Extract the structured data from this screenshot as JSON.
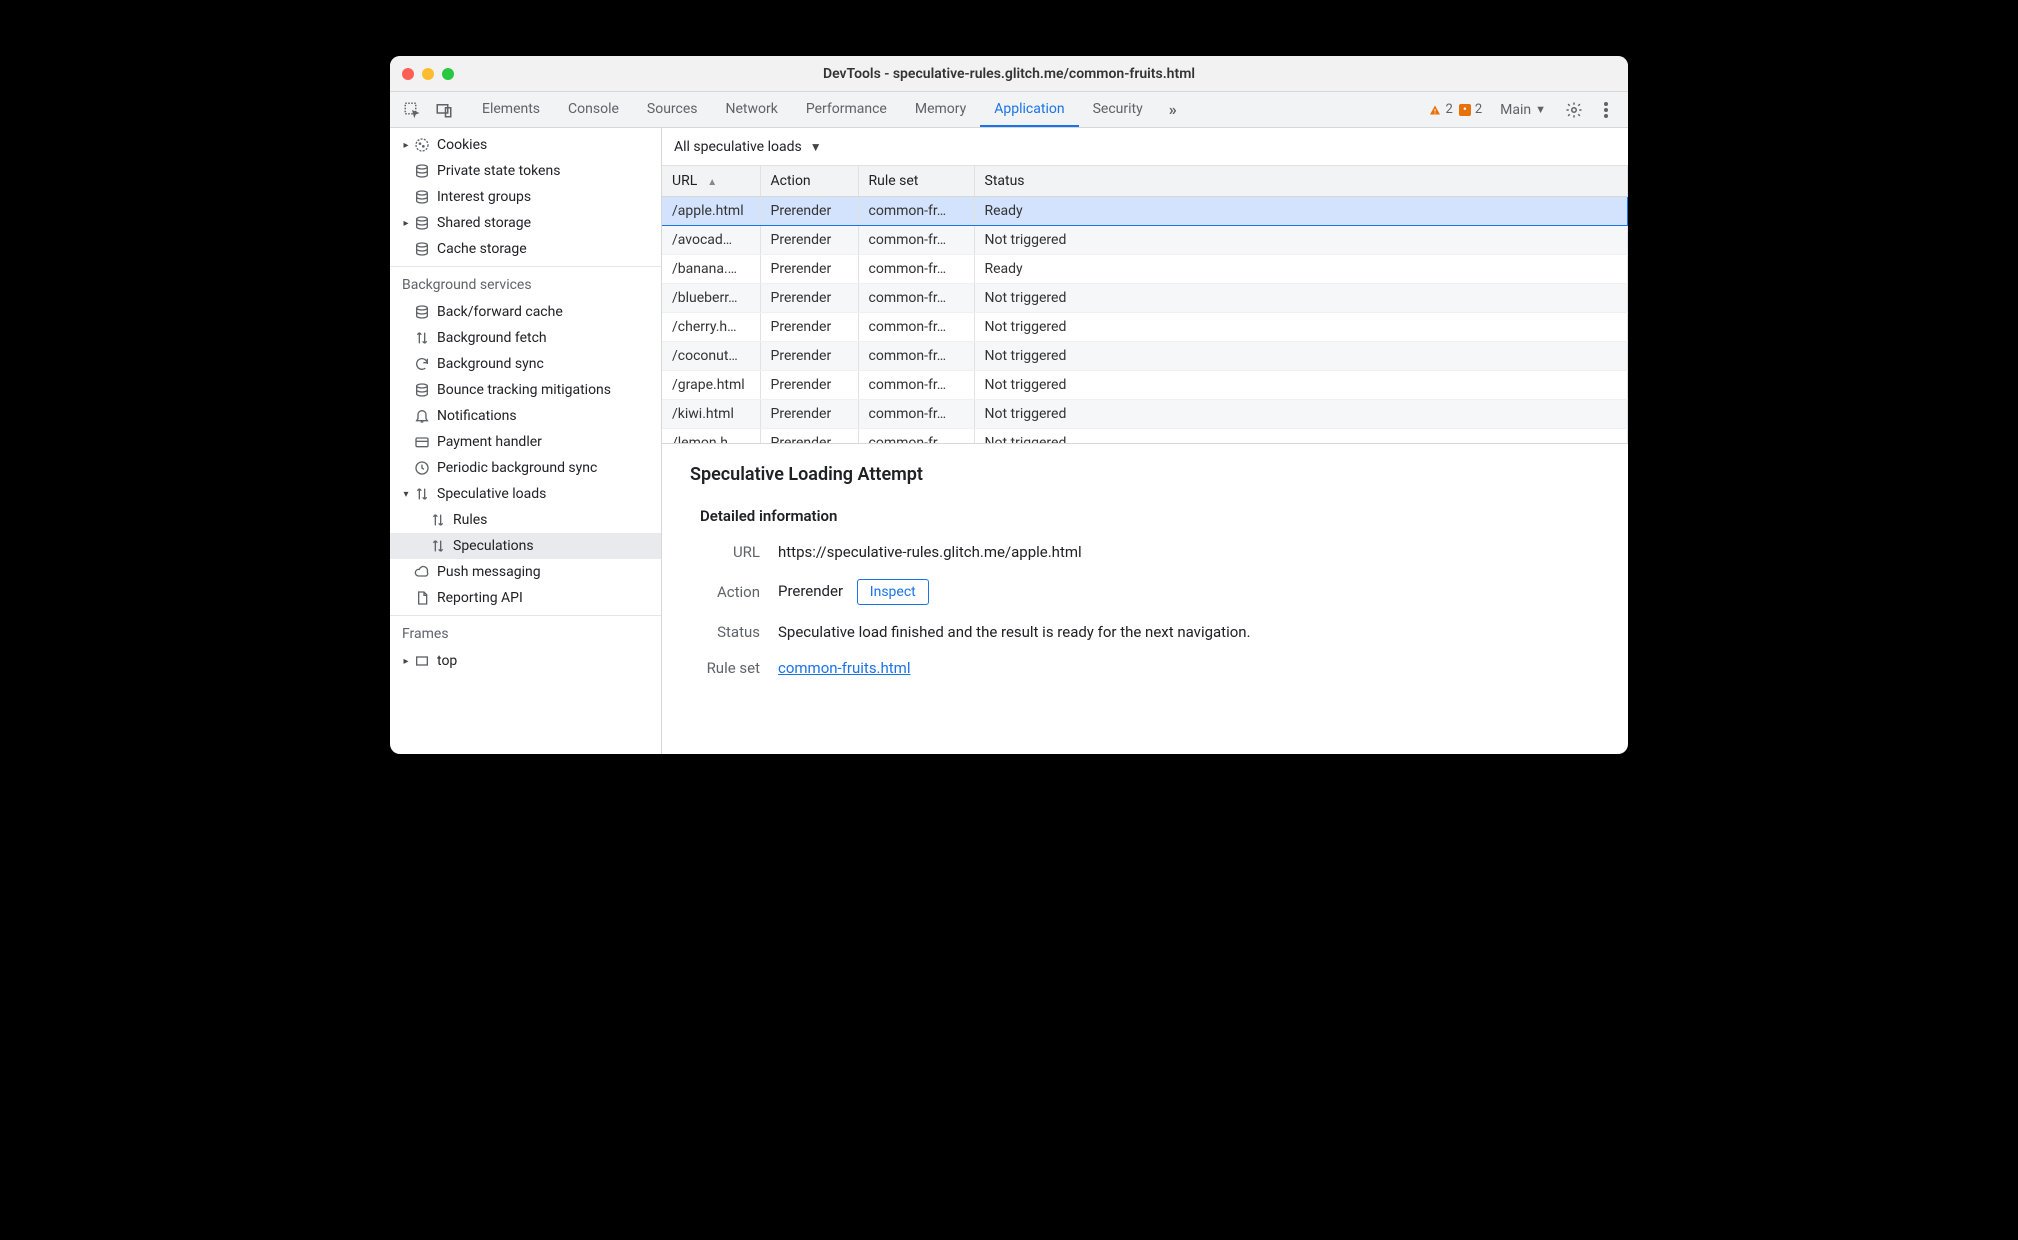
{
  "window": {
    "title": "DevTools - speculative-rules.glitch.me/common-fruits.html"
  },
  "toolbar": {
    "tabs": [
      "Elements",
      "Console",
      "Sources",
      "Network",
      "Performance",
      "Memory",
      "Application",
      "Security"
    ],
    "active_tab_index": 6,
    "warnings_count": "2",
    "issues_count": "2",
    "context": "Main"
  },
  "sidebar": {
    "group1_items": [
      {
        "label": "Cookies",
        "icon": "cookie",
        "caret": "right",
        "indent": 0
      },
      {
        "label": "Private state tokens",
        "icon": "db",
        "indent": 0
      },
      {
        "label": "Interest groups",
        "icon": "db",
        "indent": 0
      },
      {
        "label": "Shared storage",
        "icon": "db",
        "caret": "right",
        "indent": 0
      },
      {
        "label": "Cache storage",
        "icon": "db",
        "indent": 0
      }
    ],
    "group2_label": "Background services",
    "group2_items": [
      {
        "label": "Back/forward cache",
        "icon": "db",
        "indent": 0
      },
      {
        "label": "Background fetch",
        "icon": "arrows",
        "indent": 0
      },
      {
        "label": "Background sync",
        "icon": "sync",
        "indent": 0
      },
      {
        "label": "Bounce tracking mitigations",
        "icon": "db",
        "indent": 0
      },
      {
        "label": "Notifications",
        "icon": "bell",
        "indent": 0
      },
      {
        "label": "Payment handler",
        "icon": "card",
        "indent": 0
      },
      {
        "label": "Periodic background sync",
        "icon": "clock",
        "indent": 0
      },
      {
        "label": "Speculative loads",
        "icon": "arrows",
        "caret": "down",
        "indent": 0
      },
      {
        "label": "Rules",
        "icon": "arrows",
        "indent": 1
      },
      {
        "label": "Speculations",
        "icon": "arrows",
        "indent": 1,
        "selected": true
      },
      {
        "label": "Push messaging",
        "icon": "cloud",
        "indent": 0
      },
      {
        "label": "Reporting API",
        "icon": "file",
        "indent": 0
      }
    ],
    "group3_label": "Frames",
    "group3_items": [
      {
        "label": "top",
        "icon": "frame",
        "caret": "right",
        "indent": 0
      }
    ]
  },
  "filter": {
    "label": "All speculative loads"
  },
  "table": {
    "columns": [
      "URL",
      "Action",
      "Rule set",
      "Status"
    ],
    "sort_col_index": 0,
    "rows": [
      {
        "url": "/apple.html",
        "action": "Prerender",
        "ruleset": "common-fr…",
        "status": "Ready",
        "selected": true
      },
      {
        "url": "/avocad…",
        "action": "Prerender",
        "ruleset": "common-fr…",
        "status": "Not triggered"
      },
      {
        "url": "/banana.…",
        "action": "Prerender",
        "ruleset": "common-fr…",
        "status": "Ready"
      },
      {
        "url": "/blueberr…",
        "action": "Prerender",
        "ruleset": "common-fr…",
        "status": "Not triggered"
      },
      {
        "url": "/cherry.h…",
        "action": "Prerender",
        "ruleset": "common-fr…",
        "status": "Not triggered"
      },
      {
        "url": "/coconut…",
        "action": "Prerender",
        "ruleset": "common-fr…",
        "status": "Not triggered"
      },
      {
        "url": "/grape.html",
        "action": "Prerender",
        "ruleset": "common-fr…",
        "status": "Not triggered"
      },
      {
        "url": "/kiwi.html",
        "action": "Prerender",
        "ruleset": "common-fr…",
        "status": "Not triggered"
      },
      {
        "url": "/lemon.h…",
        "action": "Prerender",
        "ruleset": "common-fr…",
        "status": "Not triggered"
      }
    ]
  },
  "detail": {
    "heading": "Speculative Loading Attempt",
    "subheading": "Detailed information",
    "url_label": "URL",
    "url_value": "https://speculative-rules.glitch.me/apple.html",
    "action_label": "Action",
    "action_value": "Prerender",
    "inspect_btn": "Inspect",
    "status_label": "Status",
    "status_value": "Speculative load finished and the result is ready for the next navigation.",
    "ruleset_label": "Rule set",
    "ruleset_value": "common-fruits.html"
  }
}
